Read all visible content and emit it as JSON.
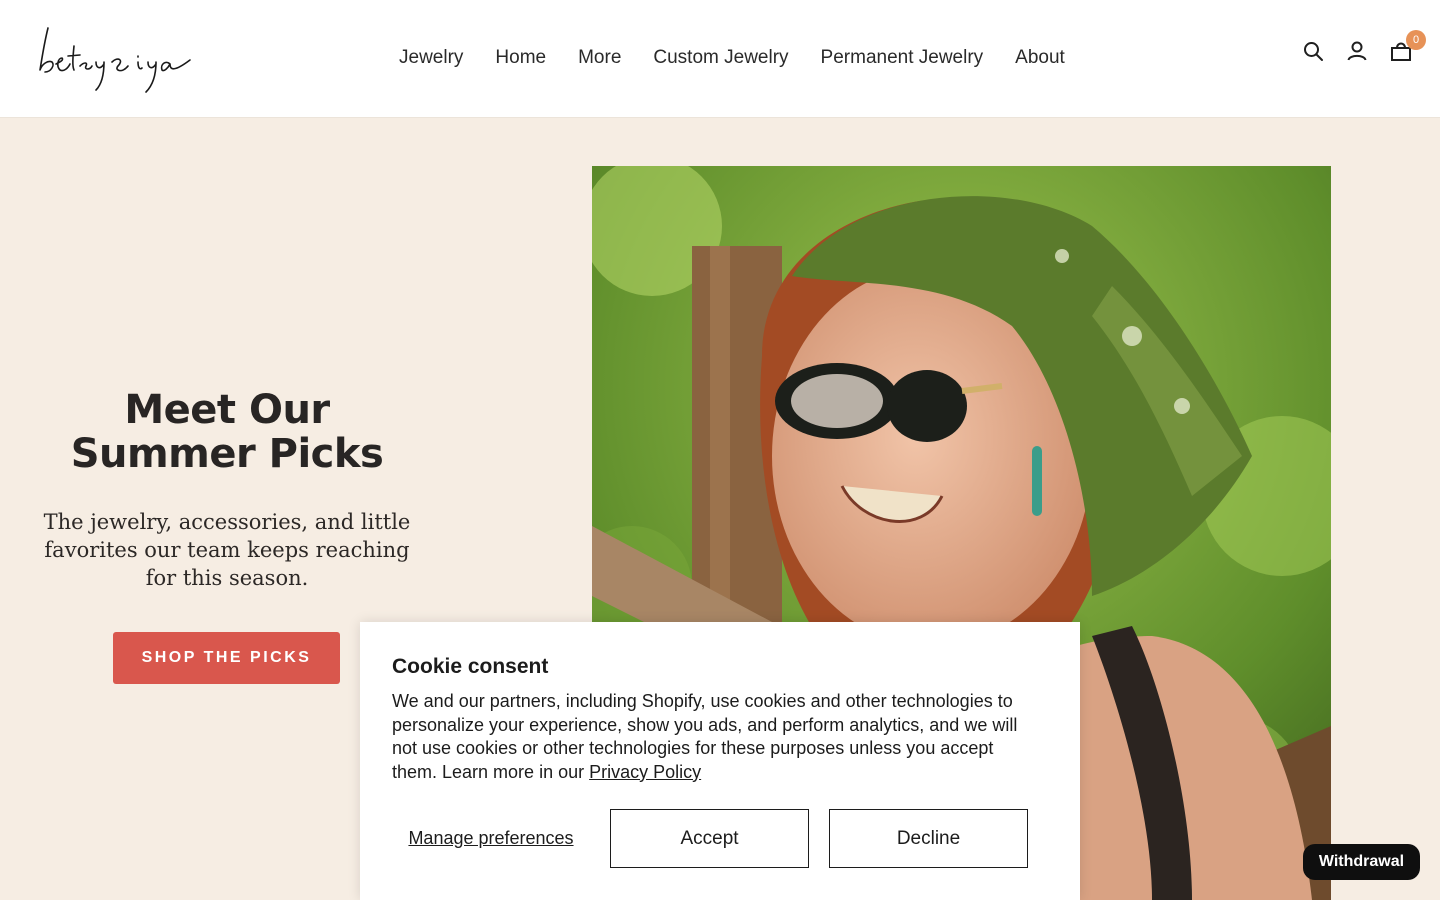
{
  "header": {
    "logo_alt": "betsy & iya",
    "nav": [
      "Jewelry",
      "Home",
      "More",
      "Custom Jewelry",
      "Permanent Jewelry",
      "About"
    ],
    "cart_count": "0",
    "icons": [
      "search-icon",
      "account-icon",
      "cart-icon"
    ]
  },
  "hero": {
    "title": "Meet Our Summer Picks",
    "subtitle": "The jewelry, accessories, and little favorites our team keeps reaching for this season.",
    "cta_label": "SHOP THE PICKS"
  },
  "cookie": {
    "title": "Cookie consent",
    "body": "We and our partners, including Shopify, use cookies and other technologies to personalize your experience, show you ads, and perform analytics, and we will not use cookies or other technologies for these purposes unless you accept them. Learn more in our",
    "privacy_link": "Privacy Policy",
    "manage_label": "Manage preferences",
    "accept_label": "Accept",
    "decline_label": "Decline"
  },
  "withdrawal_label": "Withdrawal",
  "colors": {
    "hero_bg": "#f6ede3",
    "cta_bg": "#d9574d",
    "badge": "#e79257",
    "text": "#282524"
  }
}
